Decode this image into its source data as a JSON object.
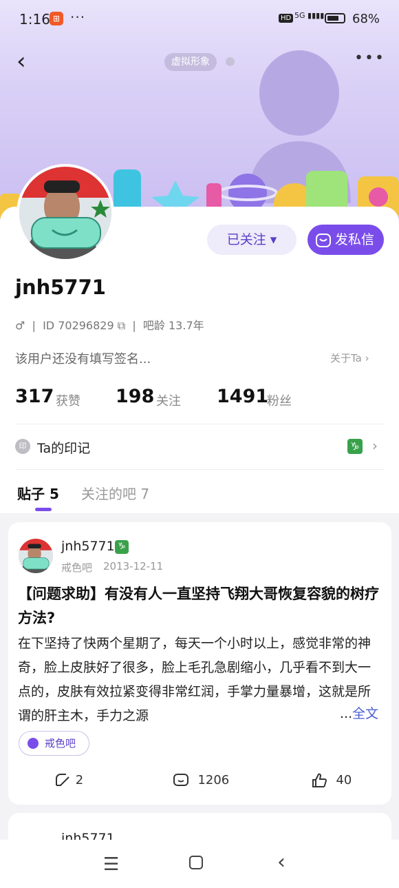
{
  "status_bar": {
    "time": "1:16",
    "dots": "···",
    "hd": "HD",
    "signal": "5G",
    "battery": "68%"
  },
  "header": {
    "virtual_label": "虚拟形象"
  },
  "profile": {
    "follow_btn": "已关注",
    "message_btn": "发私信",
    "username": "jnh5771",
    "gender_symbol": "♂",
    "id_text": "ID 70296829",
    "age_text": "吧龄 13.7年",
    "signature": "该用户还没有填写签名...",
    "about": "关于Ta",
    "stats": [
      {
        "num": "317",
        "label": "获赞"
      },
      {
        "num": "198",
        "label": "关注"
      },
      {
        "num": "1491",
        "label": "粉丝"
      }
    ],
    "seal_icon": "印",
    "seal_label": "Ta的印记",
    "capricorn": "♑"
  },
  "tabs": [
    {
      "label": "贴子 5"
    },
    {
      "label": "关注的吧 7"
    }
  ],
  "post": {
    "author": "jnh5771",
    "forum": "戒色吧",
    "date": "2013-12-11",
    "title": "【问题求助】有没有人一直坚持飞翔大哥恢复容貌的树疗方法?",
    "body": "在下坚持了快两个星期了，每天一个小时以上，感觉非常的神奇，脸上皮肤好了很多，脸上毛孔急剧缩小，几乎看不到大一点的，皮肤有效拉紧变得非常红润，手掌力量暴增，这就是所谓的肝主木，手力之源",
    "ellipsis": "...",
    "full_text": "全文",
    "tag": "戒色吧",
    "shares": "2",
    "comments": "1206",
    "likes": "40"
  },
  "post2": {
    "author": "jnh5771"
  },
  "colors": {
    "accent": "#7a4dea",
    "link": "#4a5fd0",
    "capricorn": "#3aa14b"
  }
}
